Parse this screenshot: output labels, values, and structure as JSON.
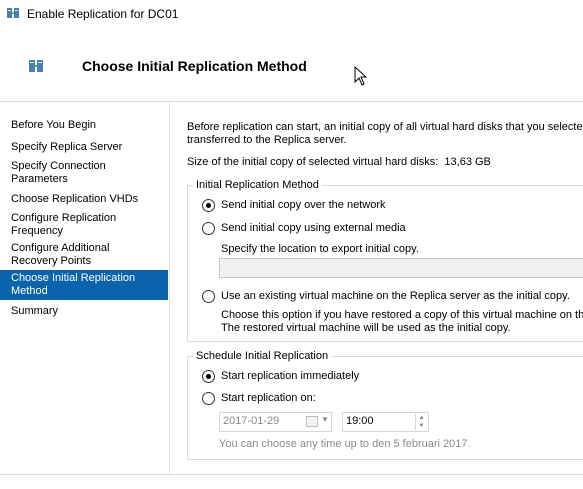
{
  "window": {
    "title": "Enable Replication for DC01",
    "icon": "server-replication-icon"
  },
  "header": {
    "title": "Choose Initial Replication Method",
    "icon": "server-replication-icon"
  },
  "nav": {
    "items": [
      {
        "label": "Before You Begin"
      },
      {
        "label": "Specify Replica Server"
      },
      {
        "label_1": "Specify Connection",
        "label_2": "Parameters"
      },
      {
        "label": "Choose Replication VHDs"
      },
      {
        "label_1": "Configure Replication",
        "label_2": "Frequency"
      },
      {
        "label_1": "Configure Additional",
        "label_2": "Recovery Points"
      },
      {
        "label_1": "Choose Initial Replication",
        "label_2": "Method"
      },
      {
        "label": "Summary"
      }
    ],
    "active_index": 6,
    "active_color": "#0a64ad"
  },
  "content": {
    "intro_1": "Before replication can start, an initial copy of all virtual hard disks that you selected",
    "intro_2": "transferred to the Replica server.",
    "size_label": "Size of the initial copy of selected virtual hard disks:",
    "size_value": "13,63 GB",
    "method_group": {
      "title": "Initial Replication Method",
      "options": {
        "network": "Send initial copy over the network",
        "external": "Send initial copy using external media",
        "external_hint": "Specify the location to export initial copy.",
        "existing": "Use an existing virtual machine on the Replica server as the initial copy.",
        "existing_hint_1": "Choose this option if you have restored a copy of this virtual machine on the",
        "existing_hint_2": "The restored virtual machine will be used as the initial copy."
      },
      "selected": "network",
      "export_location_value": ""
    },
    "schedule_group": {
      "title": "Schedule Initial Replication",
      "immediately": "Start replication immediately",
      "on": "Start replication on:",
      "selected": "immediately",
      "date": "2017-01-29",
      "time": "19:00",
      "hint": "You can choose any time up to den 5 februari 2017."
    }
  }
}
